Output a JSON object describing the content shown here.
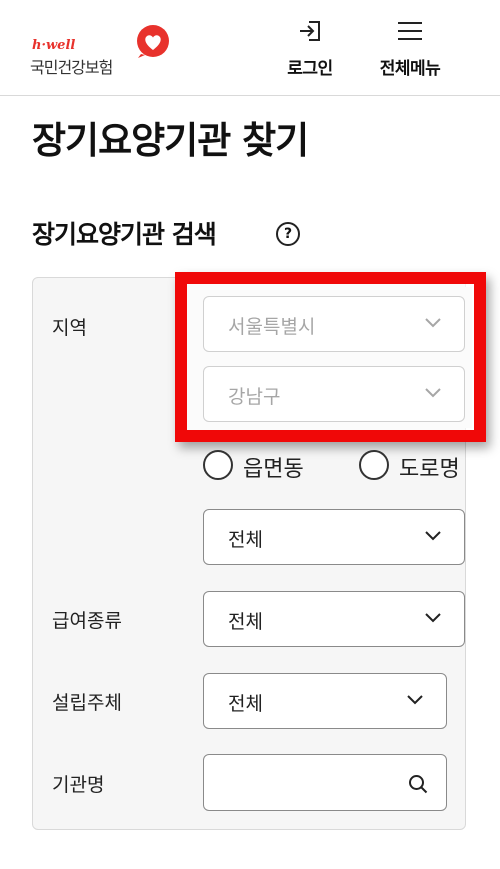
{
  "header": {
    "logo_small": "h·well",
    "logo_main": "국민건강보험",
    "login_label": "로그인",
    "menu_label": "전체메뉴"
  },
  "page": {
    "title": "장기요양기관 찾기",
    "section_title": "장기요양기관 검색",
    "help_symbol": "?"
  },
  "form": {
    "region_label": "지역",
    "city_value": "서울특별시",
    "district_value": "강남구",
    "radio_eupmyeondong": "읍면동",
    "radio_road": "도로명",
    "dong_value": "전체",
    "benefit_label": "급여종류",
    "benefit_value": "전체",
    "founder_label": "설립주체",
    "founder_value": "전체",
    "name_label": "기관명",
    "name_value": ""
  },
  "colors": {
    "highlight": "#f00808",
    "brand": "#e8322c"
  },
  "icons": [
    "login-icon",
    "menu-icon",
    "help-icon",
    "chevron-down-icon",
    "search-icon",
    "heart-logo-icon"
  ]
}
